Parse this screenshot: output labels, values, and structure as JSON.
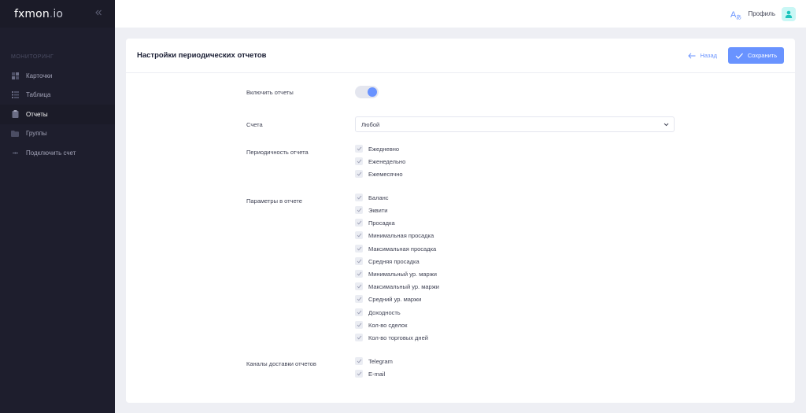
{
  "brand": {
    "name": "fxmon",
    "dot": ".",
    "suffix": "io"
  },
  "sidebar": {
    "section_title": "МОНИТОРИНГ",
    "items": [
      {
        "label": "Карточки",
        "icon": "cards-icon",
        "active": false
      },
      {
        "label": "Таблица",
        "icon": "table-icon",
        "active": false
      },
      {
        "label": "Отчеты",
        "icon": "report-icon",
        "active": true
      },
      {
        "label": "Группы",
        "icon": "folder-icon",
        "active": false
      },
      {
        "label": "Подключить счет",
        "icon": "plus-icon",
        "active": false
      }
    ]
  },
  "header": {
    "profile_label": "Профиль"
  },
  "page": {
    "title": "Настройки периодических отчетов",
    "back_label": "Назад",
    "save_label": "Сохранить"
  },
  "form": {
    "enable_label": "Включить отчеты",
    "enabled": true,
    "accounts_label": "Счета",
    "accounts_value": "Любой",
    "frequency_label": "Периодичность отчета",
    "frequency_options": [
      {
        "label": "Ежедневно",
        "checked": true
      },
      {
        "label": "Еженедельно",
        "checked": true
      },
      {
        "label": "Ежемесячно",
        "checked": true
      }
    ],
    "params_label": "Параметры в отчете",
    "params_options": [
      {
        "label": "Баланс",
        "checked": true
      },
      {
        "label": "Эквити",
        "checked": true
      },
      {
        "label": "Просадка",
        "checked": true
      },
      {
        "label": "Минимальная просадка",
        "checked": true
      },
      {
        "label": "Максимальная просадка",
        "checked": true
      },
      {
        "label": "Средняя просадка",
        "checked": true
      },
      {
        "label": "Минимальный ур. маржи",
        "checked": true
      },
      {
        "label": "Максимальный ур. маржи",
        "checked": true
      },
      {
        "label": "Средний ур. маржи",
        "checked": true
      },
      {
        "label": "Доходность",
        "checked": true
      },
      {
        "label": "Кол-во сделок",
        "checked": true
      },
      {
        "label": "Кол-во торговых дней",
        "checked": true
      }
    ],
    "channels_label": "Каналы доставки отчетов",
    "channels_options": [
      {
        "label": "Telegram",
        "checked": true
      },
      {
        "label": "E-mail",
        "checked": true
      }
    ]
  },
  "colors": {
    "accent": "#6993ff",
    "sidebar_bg": "#1e1e2d",
    "page_bg": "#eeeff4"
  }
}
